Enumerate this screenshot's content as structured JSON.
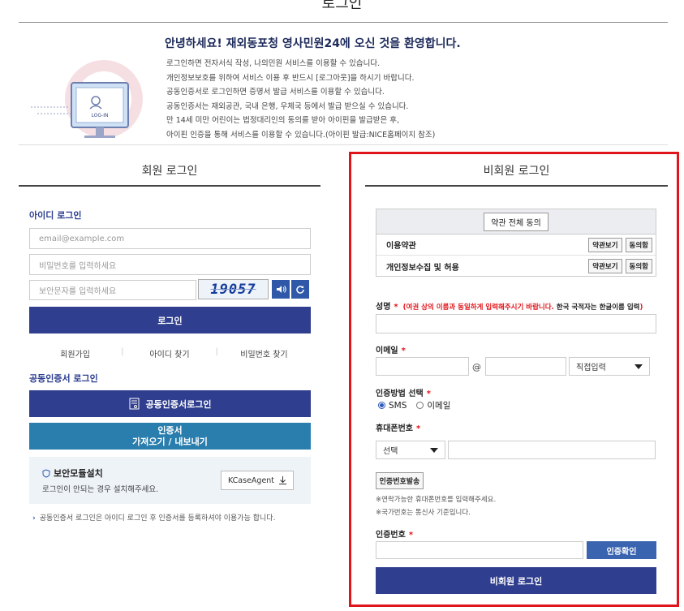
{
  "page": {
    "title": "로그인"
  },
  "welcome": {
    "title": "안녕하세요! 재외동포청 영사민원24에 오신 것을 환영합니다.",
    "lines": [
      "로그인하면 전자서식 작성, 나의민원 서비스를 이용할 수 있습니다.",
      "개인정보보호를 위하여 서비스 이용 후 반드시 [로그아웃]을 하시기 바랍니다.",
      "공동인증서로 로그인하면 증명서 발급 서비스를 이용할 수 있습니다.",
      "공동인증서는 재외공관, 국내 은행, 우체국 등에서 발급 받으실 수 있습니다.",
      "만 14세 미만 어린이는 법정대리인의 동의를 받아 아이핀을 발급받은 후,",
      "아이핀 인증을 통해 서비스를 이용할 수 있습니다.(아이핀 발급:NICE홈페이지 참조)"
    ],
    "illustration_text": "LOG-IN"
  },
  "member": {
    "title": "회원 로그인",
    "id_login_heading": "아이디 로그인",
    "email_placeholder": "email@example.com",
    "password_placeholder": "비밀번호를 입력하세요",
    "captcha_placeholder": "보안문자를 입력하세요",
    "captcha_code": "19057",
    "login_button": "로그인",
    "links": [
      "회원가입",
      "아이디 찾기",
      "비밀번호 찾기"
    ],
    "cert_heading": "공동인증서 로그인",
    "cert_login_button": "공동인증서로그인",
    "cert_io_line1": "인증서",
    "cert_io_line2": "가져오기 / 내보내기",
    "security_title": "보안모듈설치",
    "security_sub": "로그인이 안되는 경우 설치해주세요.",
    "kcase_button": "KCaseAgent",
    "notice": "공동인증서 로그인은 아이디 로그인 후 인증서를 등록하셔야 이용가능 합니다."
  },
  "nonmember": {
    "title": "비회원 로그인",
    "agree_all": "약관 전체 동의",
    "terms": [
      {
        "name": "이용약관",
        "view": "약관보기",
        "agree": "동의함"
      },
      {
        "name": "개인정보수집 및 허용",
        "view": "약관보기",
        "agree": "동의함"
      }
    ],
    "name_label": "성명",
    "name_note_red": "(여권 상의 이름과 동일하게 입력해주시기 바랍니다.",
    "name_note_black": "한국 국적자는 한글이름 입력",
    "name_note_close": ")",
    "email_label": "이메일",
    "at_sign": "@",
    "email_domain_select": "직접입력",
    "auth_method_label": "인증방법 선택",
    "auth_methods": [
      "SMS",
      "이메일"
    ],
    "auth_method_selected": "SMS",
    "phone_label": "휴대폰번호",
    "phone_country_select": "선택",
    "send_code_button": "인증번호발송",
    "hint1": "※연락가능한 휴대폰번호를 입력해주세요.",
    "hint2": "※국가번호는 통신사 기준입니다.",
    "code_label": "인증번호",
    "verify_button": "인증확인",
    "login_button": "비회원 로그인",
    "required_mark": "*"
  },
  "colors": {
    "navy": "#2f3e8e",
    "teal": "#2a7ead",
    "blue": "#3a64b0",
    "highlight_red": "#e0151b"
  }
}
